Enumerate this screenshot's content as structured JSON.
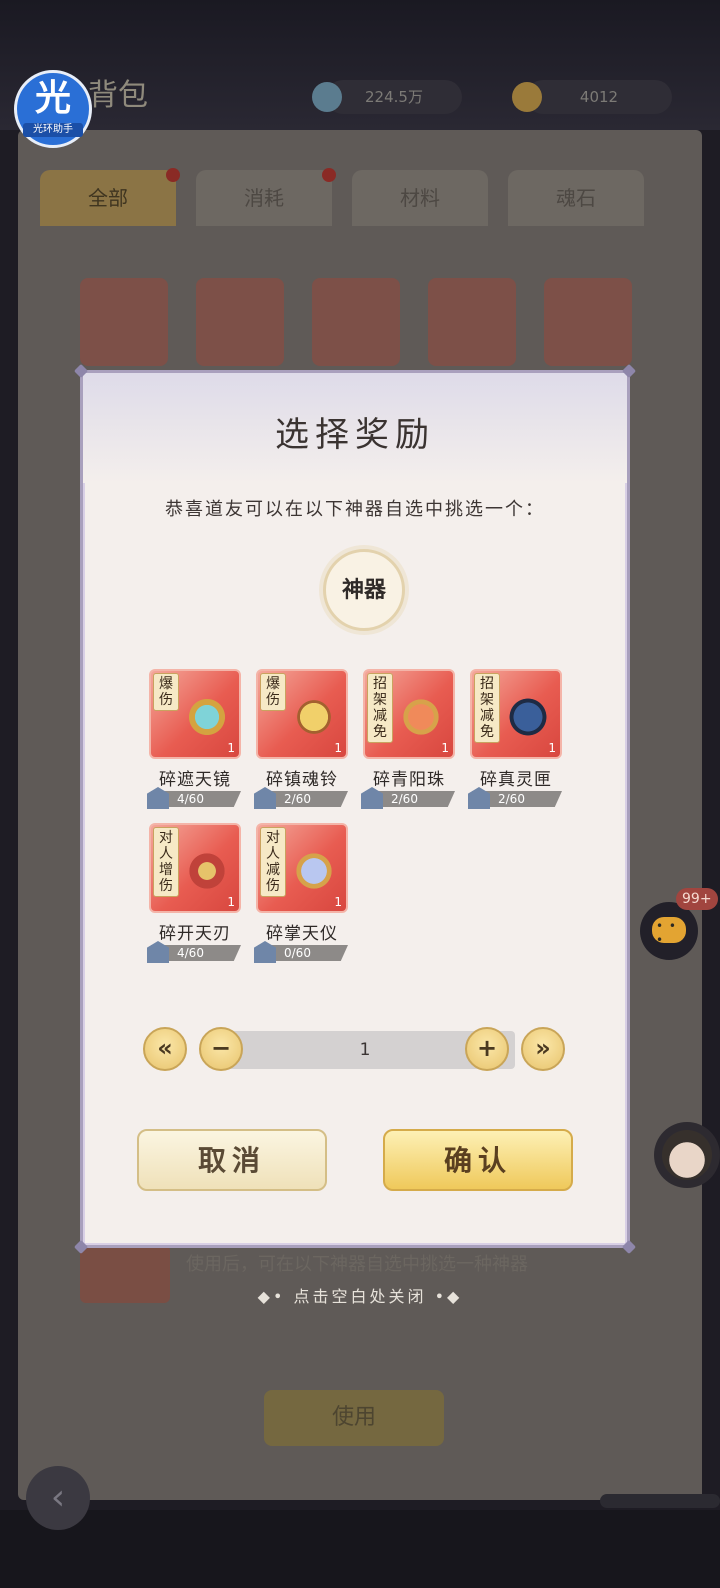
{
  "background": {
    "title": "背包",
    "resources": [
      {
        "icon": "spirit-stone-icon",
        "value": "224.5万"
      },
      {
        "icon": "lightning-icon",
        "value": "4012"
      }
    ],
    "tabs": [
      {
        "label": "全部"
      },
      {
        "label": "消耗"
      },
      {
        "label": "材料"
      },
      {
        "label": "魂石"
      }
    ],
    "description": "使用后，可在以下神器自选中挑选一种神器",
    "use_button": "使用"
  },
  "app_logo": {
    "glyph": "光",
    "text": "光环助手"
  },
  "chat": {
    "badge": "99+"
  },
  "dialog": {
    "title": "选择奖励",
    "subtitle": "恭喜道友可以在以下神器自选中挑选一个：",
    "category": "神器",
    "items": [
      {
        "tag": "爆伤",
        "name": "碎遮天镜",
        "progress": "4/60",
        "count": "1"
      },
      {
        "tag": "爆伤",
        "name": "碎镇魂铃",
        "progress": "2/60",
        "count": "1"
      },
      {
        "tag": "招架减免",
        "name": "碎青阳珠",
        "progress": "2/60",
        "count": "1"
      },
      {
        "tag": "招架减免",
        "name": "碎真灵匣",
        "progress": "2/60",
        "count": "1"
      },
      {
        "tag": "对人增伤",
        "name": "碎开天刃",
        "progress": "4/60",
        "count": "1"
      },
      {
        "tag": "对人减伤",
        "name": "碎掌天仪",
        "progress": "0/60",
        "count": "1"
      }
    ],
    "quantity": {
      "min_label": "«",
      "minus_label": "−",
      "value": "1",
      "plus_label": "+",
      "max_label": "»"
    },
    "cancel_label": "取消",
    "confirm_label": "确认"
  },
  "close_hint": "◆• 点击空白处关闭 •◆"
}
